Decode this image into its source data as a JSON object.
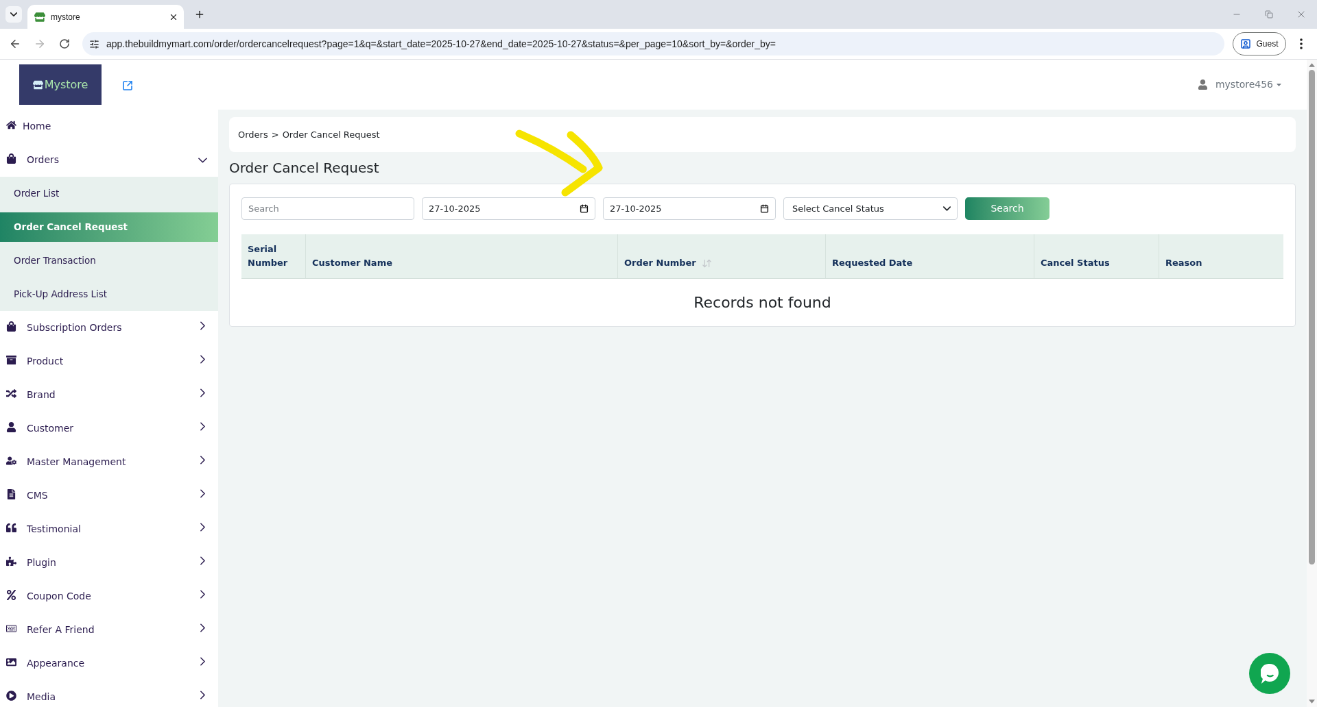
{
  "browser": {
    "tab": {
      "title": "mystore"
    },
    "address_bar": {
      "url": "app.thebuildmymart.com/order/ordercancelrequest?page=1&q=&start_date=2025-10-27&end_date=2025-10-27&status=&per_page=10&sort_by=&order_by="
    },
    "profile": {
      "label": "Guest"
    }
  },
  "header": {
    "logo": "Mystore",
    "user": {
      "name": "mystore456"
    }
  },
  "sidebar": {
    "items": [
      {
        "kind": "link",
        "label": "Home",
        "selected": false
      },
      {
        "kind": "group",
        "label": "Orders",
        "selected": false,
        "expanded": true,
        "children": [
          {
            "label": "Order List",
            "selected": false
          },
          {
            "label": "Order Cancel Request",
            "selected": true
          },
          {
            "label": "Order Transaction",
            "selected": false
          },
          {
            "label": "Pick-Up Address List",
            "selected": false
          }
        ]
      },
      {
        "kind": "group",
        "label": "Subscription Orders",
        "selected": false,
        "expanded": false
      },
      {
        "kind": "group",
        "label": "Product",
        "selected": false,
        "expanded": false
      },
      {
        "kind": "group",
        "label": "Brand",
        "selected": false,
        "expanded": false
      },
      {
        "kind": "group",
        "label": "Customer",
        "selected": false,
        "expanded": false
      },
      {
        "kind": "group",
        "label": "Master Management",
        "selected": false,
        "expanded": false
      },
      {
        "kind": "group",
        "label": "CMS",
        "selected": false,
        "expanded": false
      },
      {
        "kind": "group",
        "label": "Testimonial",
        "selected": false,
        "expanded": false
      },
      {
        "kind": "group",
        "label": "Plugin",
        "selected": false,
        "expanded": false
      },
      {
        "kind": "group",
        "label": "Coupon Code",
        "selected": false,
        "expanded": false
      },
      {
        "kind": "group",
        "label": "Refer A Friend",
        "selected": false,
        "expanded": false
      },
      {
        "kind": "group",
        "label": "Appearance",
        "selected": false,
        "expanded": false
      },
      {
        "kind": "group",
        "label": "Media",
        "selected": false,
        "expanded": false
      }
    ]
  },
  "breadcrumb": {
    "items": [
      "Orders",
      "Order Cancel Request"
    ],
    "separator": ">"
  },
  "page_title": "Order Cancel Request",
  "filters": {
    "search": {
      "placeholder": "Search"
    },
    "start_date": {
      "value": "27-10-2025"
    },
    "end_date": {
      "value": "27-10-2025"
    },
    "cancel_status": {
      "placeholder": "Select Cancel Status"
    },
    "search_button": "Search"
  },
  "table": {
    "columns": [
      {
        "label": "Serial Number",
        "sortable": false
      },
      {
        "label": "Customer Name",
        "sortable": false
      },
      {
        "label": "Order Number",
        "sortable": true
      },
      {
        "label": "Requested Date",
        "sortable": false
      },
      {
        "label": "Cancel Status",
        "sortable": false
      },
      {
        "label": "Reason",
        "sortable": false
      }
    ],
    "empty_message": "Records not found"
  }
}
